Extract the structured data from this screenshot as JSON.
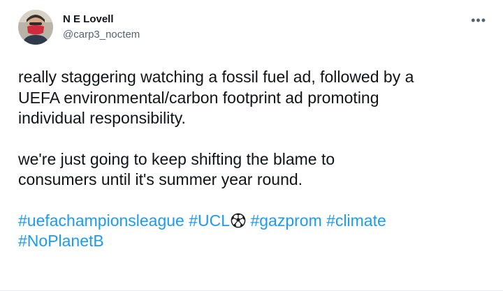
{
  "tweet": {
    "author": {
      "display_name": "N E Lovell",
      "handle": "@carp3_noctem",
      "avatar_icon": "avatar-person-red-mask"
    },
    "more_icon": "more-options-icon",
    "more_glyph": "•••",
    "paragraphs": [
      "really staggering watching a fossil fuel ad, followed by a\nUEFA environmental/carbon footprint ad promoting\nindividual responsibility.",
      "we're just going to keep shifting the blame to\nconsumers until it's summer year round."
    ],
    "hashtags": [
      "#uefachampionsleague",
      "#UCL",
      "#gazprom",
      "#climate",
      "#NoPlanetB"
    ],
    "emoji_name": "soccer-ball-icon",
    "colors": {
      "text": "#0f1419",
      "secondary": "#536471",
      "link": "#1d9bf0",
      "background": "#ffffff"
    }
  }
}
